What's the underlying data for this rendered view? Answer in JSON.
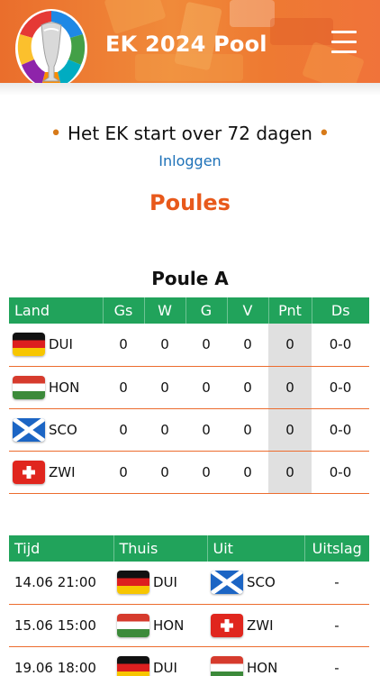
{
  "app": {
    "title": "EK 2024 Pool"
  },
  "countdown": {
    "text": "Het EK start over 72 dagen",
    "bullet": "•"
  },
  "login_label": "Inloggen",
  "section_title": "Poules",
  "group": {
    "title": "Poule A",
    "columns": [
      "Land",
      "Gs",
      "W",
      "G",
      "V",
      "Pnt",
      "Ds"
    ],
    "rows": [
      {
        "code": "DUI",
        "flag": "germany-flag",
        "gs": "0",
        "w": "0",
        "g": "0",
        "v": "0",
        "pnt": "0",
        "ds": "0-0"
      },
      {
        "code": "HON",
        "flag": "hungary-flag",
        "gs": "0",
        "w": "0",
        "g": "0",
        "v": "0",
        "pnt": "0",
        "ds": "0-0"
      },
      {
        "code": "SCO",
        "flag": "scotland-flag",
        "gs": "0",
        "w": "0",
        "g": "0",
        "v": "0",
        "pnt": "0",
        "ds": "0-0"
      },
      {
        "code": "ZWI",
        "flag": "switzerland-flag",
        "gs": "0",
        "w": "0",
        "g": "0",
        "v": "0",
        "pnt": "0",
        "ds": "0-0"
      }
    ]
  },
  "matches": {
    "columns": [
      "Tijd",
      "Thuis",
      "Uit",
      "Uitslag"
    ],
    "rows": [
      {
        "time": "14.06 21:00",
        "home": "DUI",
        "home_flag": "germany-flag",
        "away": "SCO",
        "away_flag": "scotland-flag",
        "result": "-"
      },
      {
        "time": "15.06 15:00",
        "home": "HON",
        "home_flag": "hungary-flag",
        "away": "ZWI",
        "away_flag": "switzerland-flag",
        "result": "-"
      },
      {
        "time": "19.06 18:00",
        "home": "DUI",
        "home_flag": "germany-flag",
        "away": "HON",
        "away_flag": "hungary-flag",
        "result": "-"
      }
    ]
  },
  "colors": {
    "header_orange": "#ee7a32",
    "accent_orange": "#e8591b",
    "table_green": "#21a35b",
    "link_blue": "#1d71b8",
    "row_border": "#ec6c2e",
    "points_bg": "#e0e0e0"
  },
  "icons": {
    "logo": "euro-2024-trophy-logo",
    "menu": "hamburger-menu-icon"
  }
}
